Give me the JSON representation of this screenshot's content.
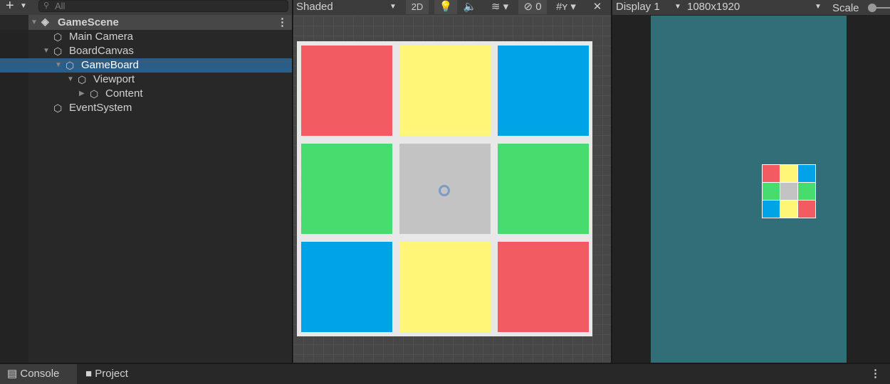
{
  "hierarchy": {
    "search_placeholder": "All",
    "scene": "GameScene",
    "items": [
      {
        "label": "Main Camera",
        "depth": 0,
        "arrow": ""
      },
      {
        "label": "BoardCanvas",
        "depth": 0,
        "arrow": "▼"
      },
      {
        "label": "GameBoard",
        "depth": 1,
        "arrow": "▼",
        "selected": true
      },
      {
        "label": "Viewport",
        "depth": 2,
        "arrow": "▼"
      },
      {
        "label": "Content",
        "depth": 3,
        "arrow": "▶"
      },
      {
        "label": "EventSystem",
        "depth": 0,
        "arrow": ""
      }
    ]
  },
  "scene_toolbar": {
    "shading_mode": "Shaded",
    "mode_2d": "2D",
    "hidden_count": "0"
  },
  "board": {
    "colors": {
      "red": "#f25b62",
      "yellow": "#fff576",
      "blue": "#00a2e8",
      "green": "#48dc6f",
      "gray": "#c3c3c3"
    },
    "grid": [
      [
        "red",
        "yellow",
        "blue"
      ],
      [
        "green",
        "gray",
        "green"
      ],
      [
        "blue",
        "yellow",
        "red"
      ]
    ]
  },
  "game_toolbar": {
    "display": "Display 1",
    "resolution": "1080x1920",
    "scale_label": "Scale"
  },
  "game_view": {
    "background": "#316e78"
  },
  "bottom_tabs": {
    "console": "Console",
    "project": "Project"
  }
}
